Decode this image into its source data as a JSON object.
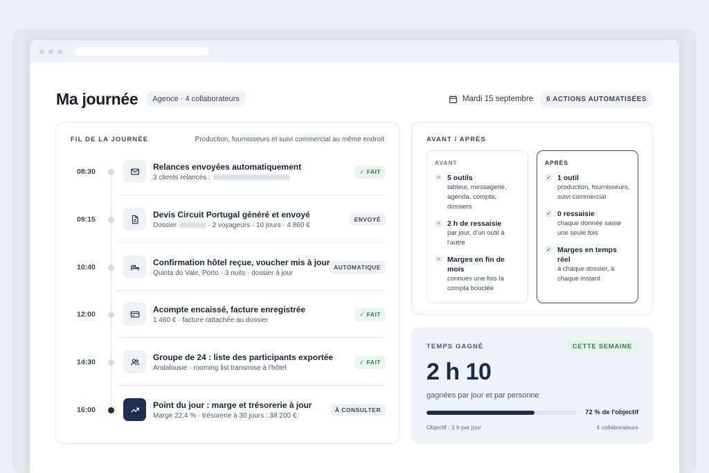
{
  "header": {
    "title": "Ma journée",
    "team_pill": "Agence · 4 collaborateurs",
    "date": "Mardi 15 septembre",
    "actions_badge": "6 ACTIONS AUTOMATISÉES"
  },
  "timeline": {
    "title": "FIL DE LA JOURNÉE",
    "subtitle": "Production, fournisseurs et suivi commercial au même endroit",
    "items": [
      {
        "time": "08:30",
        "icon": "mail-icon",
        "title": "Relances envoyées automatiquement",
        "sub": "3 clients relancés :",
        "badge": "FAIT",
        "status": "done"
      },
      {
        "time": "09:15",
        "icon": "document-icon",
        "title": "Devis Circuit Portugal généré et envoyé",
        "sub_pre": "Dossier",
        "sub": "· 2 voyageurs · 10 jours · 4 860 €",
        "badge": "ENVOYÉ",
        "status": "neutral"
      },
      {
        "time": "10:40",
        "icon": "bed-icon",
        "title": "Confirmation hôtel reçue, voucher mis à jour",
        "sub": "Quinta do Vale, Porto · 3 nuits · dossier à jour",
        "badge": "AUTOMATIQUE",
        "status": "neutral"
      },
      {
        "time": "12:00",
        "icon": "credit-card-icon",
        "title": "Acompte encaissé, facture enregistrée",
        "sub": "1 460 € · facture rattachée au dossier",
        "badge": "FAIT",
        "status": "done"
      },
      {
        "time": "14:30",
        "icon": "users-icon",
        "title": "Groupe de 24 : liste des participants exportée",
        "sub": "Andalousie · rooming list transmise à l'hôtel",
        "badge": "FAIT",
        "status": "done"
      },
      {
        "time": "16:00",
        "icon": "trending-up-icon",
        "title": "Point du jour : marge et trésorerie à jour",
        "sub": "Marge 22,4 % · trésorerie à 30 jours : 38 200 €",
        "badge": "À CONSULTER",
        "status": "active"
      }
    ]
  },
  "before_after": {
    "title": "AVANT / APRÈS",
    "before": {
      "title": "AVANT",
      "items": [
        {
          "title": "5 outils",
          "desc": "tableur, messagerie, agenda, compta, dossiers"
        },
        {
          "title": "2 h de ressaisie",
          "desc": "par jour, d'un outil à l'autre"
        },
        {
          "title": "Marges en fin de mois",
          "desc": "connues une fois la compta bouclée"
        }
      ]
    },
    "after": {
      "title": "APRÈS",
      "items": [
        {
          "title": "1 outil",
          "desc": "production, fournisseurs, suivi commercial"
        },
        {
          "title": "0 ressaisie",
          "desc": "chaque donnée saisie une seule fois"
        },
        {
          "title": "Marges en temps réel",
          "desc": "à chaque dossier, à chaque instant"
        }
      ]
    }
  },
  "time_saved": {
    "label": "TEMPS GAGNÉ",
    "period": "CETTE SEMAINE",
    "value": "2 h 10",
    "subtitle": "gagnées par jour et par personne",
    "progress": 0.72,
    "progress_label": "72 % de l'objectif",
    "goal": "Objectif : 3 h par jour",
    "collaborators": "4 collaborateurs"
  },
  "colors": {
    "navy": "#1c2f52",
    "done_green": "#2e7d4f",
    "done_bg": "#e9f6ee"
  }
}
